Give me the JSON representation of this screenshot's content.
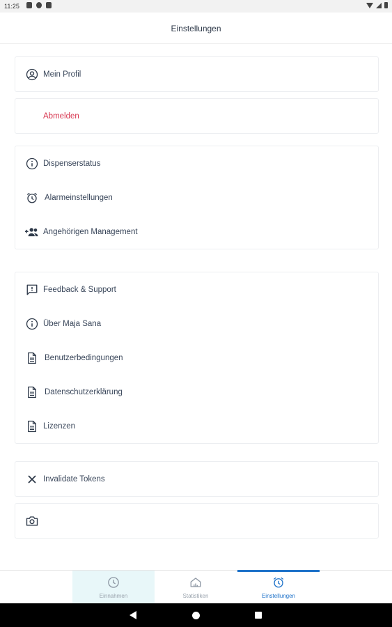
{
  "status_bar": {
    "time": "11:25"
  },
  "header": {
    "title": "Einstellungen"
  },
  "profile_card": {
    "label": "Mein Profil",
    "icon": "account-circle-icon"
  },
  "logout_card": {
    "label": "Abmelden",
    "color": "#d7354f"
  },
  "device_card": {
    "items": [
      {
        "label": "Dispenserstatus",
        "icon": "info-icon"
      },
      {
        "label": "Alarmeinstellungen",
        "icon": "alarm-clock-icon"
      },
      {
        "label": "Angehörigen Management",
        "icon": "people-add-icon"
      }
    ]
  },
  "info_card": {
    "items": [
      {
        "label": "Feedback & Support",
        "icon": "feedback-icon"
      },
      {
        "label": "Über Maja Sana",
        "icon": "info-icon"
      },
      {
        "label": "Benutzerbedingungen",
        "icon": "document-icon"
      },
      {
        "label": "Datenschutzerklärung",
        "icon": "document-icon"
      },
      {
        "label": "Lizenzen",
        "icon": "document-icon"
      }
    ]
  },
  "debug_card": {
    "label": "Invalidate Tokens",
    "icon": "close-icon"
  },
  "camera_card": {
    "icon": "camera-icon"
  },
  "bottom_nav": {
    "items": [
      {
        "label": "Einnahmen",
        "icon": "clock-icon"
      },
      {
        "label": "Statistiken",
        "icon": "home-chart-icon"
      },
      {
        "label": "Einstellungen",
        "icon": "alarm-clock-icon"
      }
    ],
    "active_color": "#1e72c9"
  }
}
